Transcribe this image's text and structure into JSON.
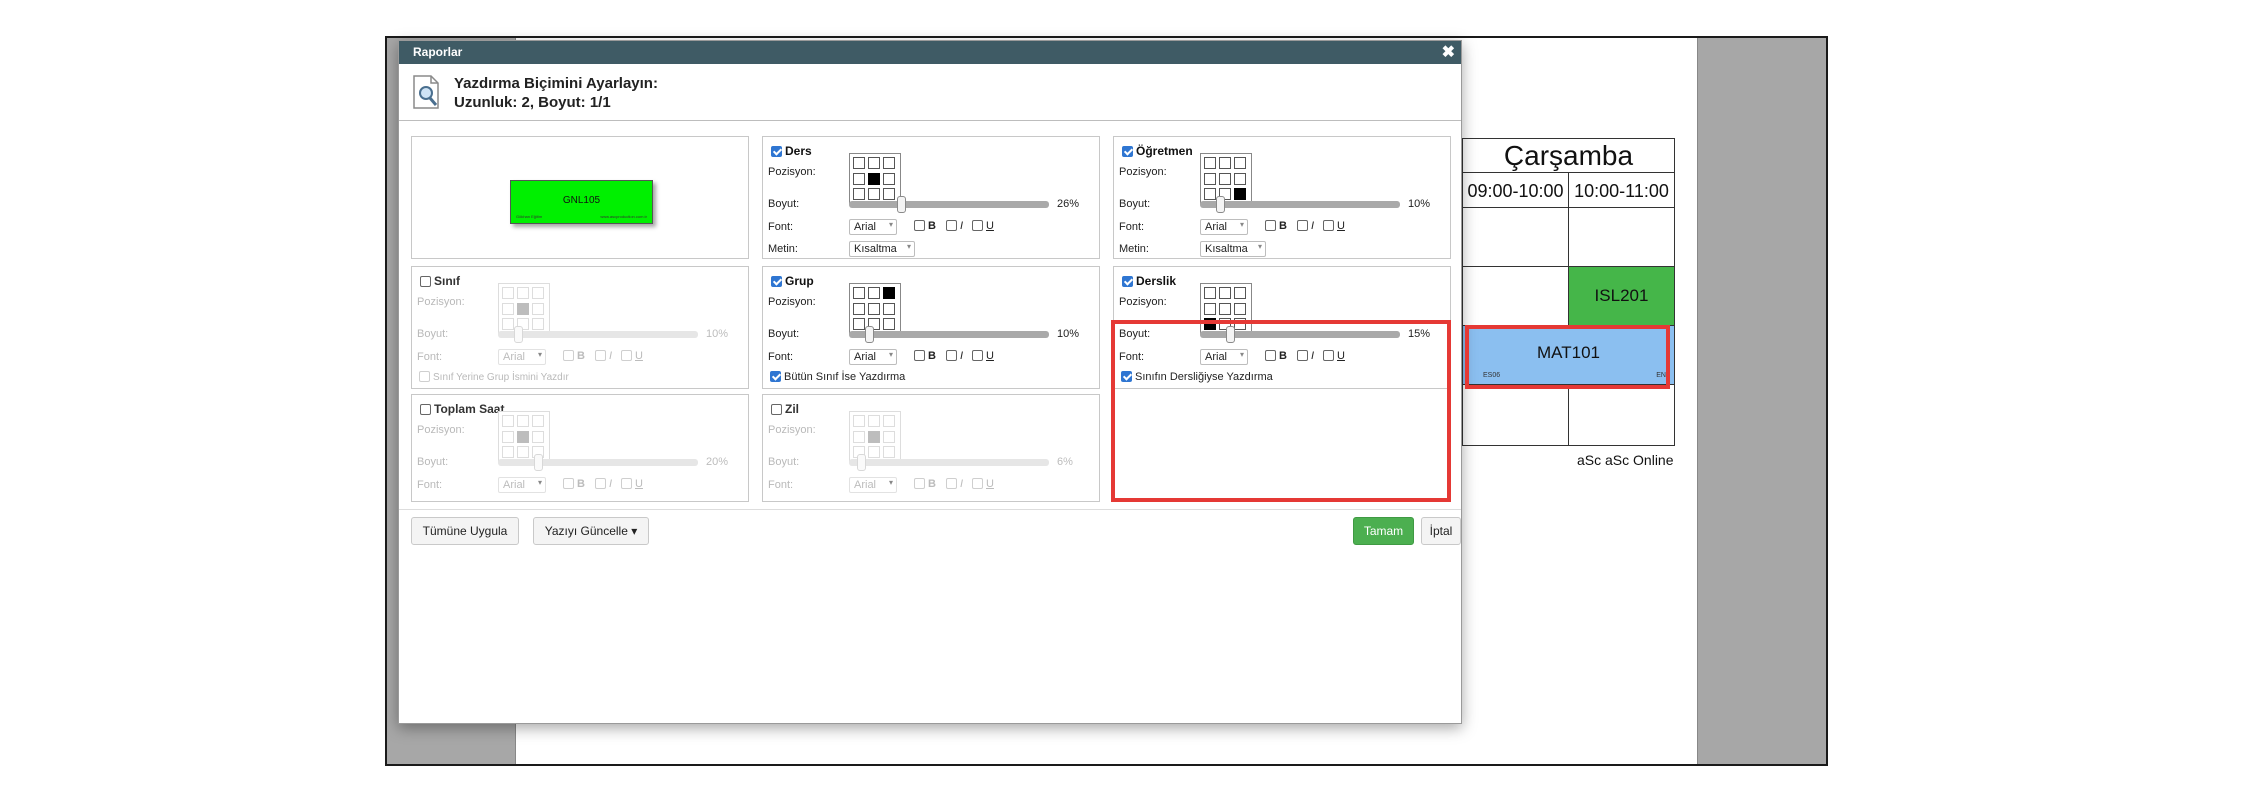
{
  "timetable": {
    "day": "Çarşamba",
    "times": [
      "09:00-10:00",
      "10:00-11:00"
    ],
    "cells": {
      "isl": {
        "code": "ISL201",
        "color": "#45b649"
      },
      "mat": {
        "code": "MAT101",
        "color": "#8bbff0",
        "left_sub": "ES06",
        "right_sub": "EN"
      }
    },
    "footer": "aSc aSc Online"
  },
  "dialog": {
    "title": "Raporlar",
    "close_icon": "close-icon",
    "header_line1": "Yazdırma Biçimini Ayarlayın:",
    "header_line2": "Uzunluk: 2, Boyut: 1/1",
    "preview": {
      "code": "GNL105",
      "left_sub": "Gökhan Eğitim",
      "right_sub": "www.ascproduction.com.tr",
      "color": "#00f000"
    },
    "labels": {
      "position": "Pozisyon:",
      "size": "Boyut:",
      "font": "Font:",
      "text": "Metin:",
      "bold": "B",
      "italic": "I",
      "underline": "U"
    },
    "panels": {
      "ders": {
        "title": "Ders",
        "checked": true,
        "size_pct": "26%",
        "size_value": 0.26,
        "font": "Arial",
        "text": "Kısaltma",
        "position_cell": 4
      },
      "ogretmen": {
        "title": "Öğretmen",
        "checked": true,
        "size_pct": "10%",
        "size_value": 0.1,
        "font": "Arial",
        "text": "Kısaltma",
        "position_cell": 8
      },
      "sinif": {
        "title": "Sınıf",
        "checked": false,
        "size_pct": "10%",
        "size_value": 0.1,
        "font": "Arial",
        "option": "Sınıf Yerine Grup İsmini Yazdır",
        "position_cell": 4
      },
      "grup": {
        "title": "Grup",
        "checked": true,
        "size_pct": "10%",
        "size_value": 0.1,
        "font": "Arial",
        "option": "Bütün Sınıf İse Yazdırma",
        "option_checked": true,
        "position_cell": 2
      },
      "derslik": {
        "title": "Derslik",
        "checked": true,
        "size_pct": "15%",
        "size_value": 0.15,
        "font": "Arial",
        "option": "Sınıfın Dersliğiyse Yazdırma",
        "option_checked": true,
        "position_cell": 6
      },
      "toplam_saat": {
        "title": "Toplam Saat",
        "checked": false,
        "size_pct": "20%",
        "size_value": 0.2,
        "font": "Arial",
        "position_cell": 4
      },
      "zil": {
        "title": "Zil",
        "checked": false,
        "size_pct": "6%",
        "size_value": 0.06,
        "font": "Arial",
        "position_cell": 4
      }
    },
    "buttons": {
      "apply_all": "Tümüne Uygula",
      "update_text": "Yazıyı Güncelle ▾",
      "ok": "Tamam",
      "cancel": "İptal"
    },
    "colors": {
      "titlebar": "#3f5b65",
      "ok": "#4caf50",
      "highlight": "#e53935"
    }
  }
}
